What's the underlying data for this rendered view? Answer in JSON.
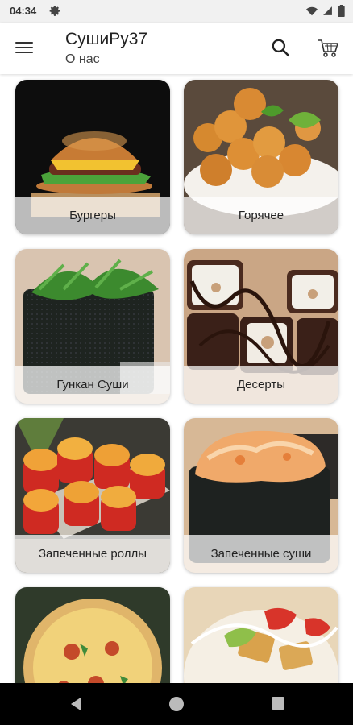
{
  "status": {
    "time": "04:34"
  },
  "header": {
    "title": "СушиРу37",
    "subtitle": "О нас"
  },
  "categories": [
    {
      "label": "Бургеры"
    },
    {
      "label": "Горячее"
    },
    {
      "label": "Гункан Суши"
    },
    {
      "label": "Десерты"
    },
    {
      "label": "Запеченные роллы"
    },
    {
      "label": "Запеченные суши"
    },
    {
      "label": ""
    },
    {
      "label": ""
    }
  ],
  "icons": {
    "menu": "hamburger-menu-icon",
    "search": "search-icon",
    "cart": "shopping-cart-icon",
    "settings": "gear-icon",
    "wifi": "wifi-icon",
    "signal": "signal-icon",
    "battery": "battery-icon"
  }
}
